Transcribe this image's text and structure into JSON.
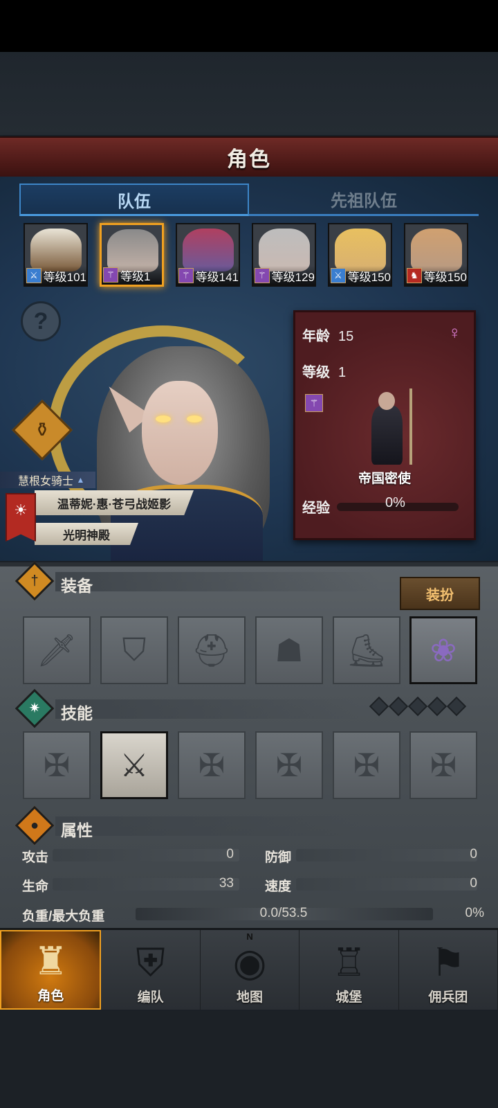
{
  "header": {
    "title": "角色"
  },
  "tabs": [
    {
      "label": "队伍"
    },
    {
      "label": "先祖队伍"
    }
  ],
  "roster": [
    {
      "level": "等级101",
      "class_icon": "sword-icon",
      "class_color": "#3a7ed0",
      "face_color": "#7a5a3a"
    },
    {
      "level": "等级1",
      "class_icon": "staff-icon",
      "class_color": "#8448b0",
      "face_color": "#c4b2a8"
    },
    {
      "level": "等级141",
      "class_icon": "staff-icon",
      "class_color": "#8448b0",
      "face_color": "#6a5a9a"
    },
    {
      "level": "等级129",
      "class_icon": "staff-icon",
      "class_color": "#8448b0",
      "face_color": "#c9b9b2"
    },
    {
      "level": "等级150",
      "class_icon": "sword-icon",
      "class_color": "#3a7ed0",
      "face_color": "#d8b070"
    },
    {
      "level": "等级150",
      "class_icon": "horse-icon",
      "class_color": "#b52a22",
      "face_color": "#b89a82"
    }
  ],
  "hero": {
    "class_title": "慧根女骑士",
    "name": "温蒂妮·惠·苍弓战姬影",
    "faction": "光明神殿"
  },
  "info": {
    "age_label": "年龄",
    "age_value": "15",
    "level_label": "等级",
    "level_value": "1",
    "job_name": "帝国密使",
    "exp_label": "经验",
    "exp_pct": "0%",
    "gender_icon": "♀"
  },
  "equipment": {
    "title": "装备",
    "dress_button": "装扮",
    "slots": [
      "sword-icon",
      "shield-icon",
      "helmet-icon",
      "armor-icon",
      "boots-icon",
      "lavender-icon"
    ]
  },
  "skills": {
    "title": "技能",
    "unlocked": 1,
    "total_pips": 5
  },
  "attributes": {
    "title": "属性",
    "attack_label": "攻击",
    "attack_value": "0",
    "defense_label": "防御",
    "defense_value": "0",
    "hp_label": "生命",
    "hp_value": "33",
    "speed_label": "速度",
    "speed_value": "0",
    "load_label": "负重/最大负重",
    "load_value": "0.0/53.5",
    "load_pct": "0%"
  },
  "nav": [
    {
      "label": "角色",
      "icon": "knight-icon",
      "active": true
    },
    {
      "label": "编队",
      "icon": "formation-icon",
      "active": false
    },
    {
      "label": "地图",
      "icon": "map-icon",
      "active": false
    },
    {
      "label": "城堡",
      "icon": "castle-icon",
      "active": false
    },
    {
      "label": "佣兵团",
      "icon": "mercenary-icon",
      "active": false
    }
  ],
  "map_compass": "N"
}
